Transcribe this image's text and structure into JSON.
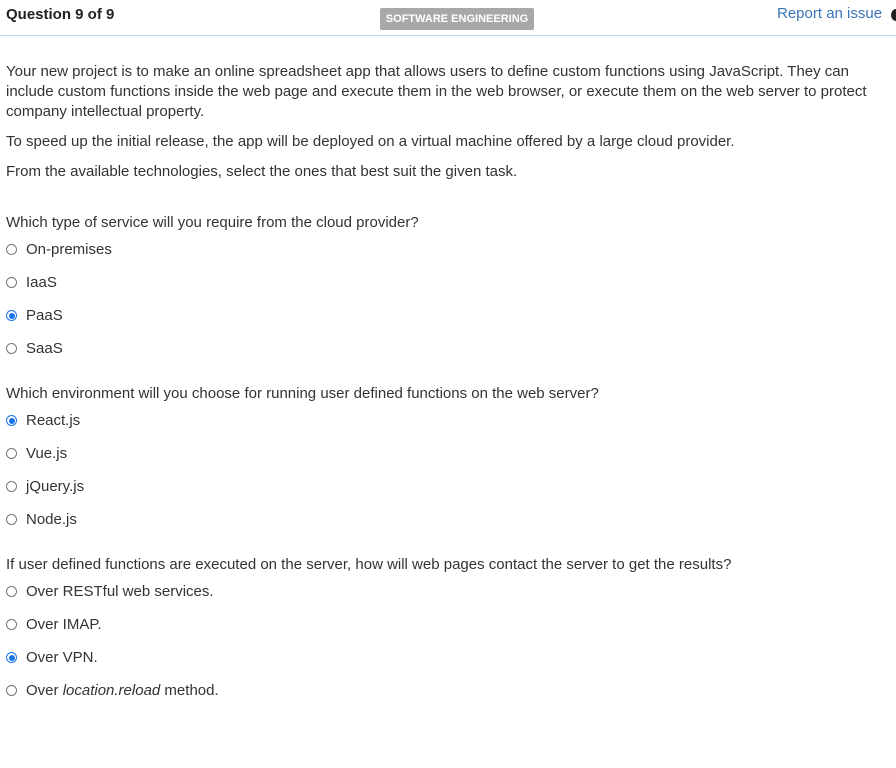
{
  "header": {
    "question_num": "Question 9 of 9",
    "category": "SOFTWARE ENGINEERING",
    "report_link": "Report an issue"
  },
  "intro": {
    "p1": "Your new project is to make an online spreadsheet app that allows users to define custom functions using JavaScript. They can include custom functions inside the web page and execute them in the web browser, or execute them on the web server to protect company intellectual property.",
    "p2": "To speed up the initial release, the app will be deployed on a virtual machine offered by a large cloud provider.",
    "p3": "From the available technologies, select the ones that best suit the given task."
  },
  "q1": {
    "prompt": "Which type of service will you require from the cloud provider?",
    "options": [
      "On-premises",
      "IaaS",
      "PaaS",
      "SaaS"
    ],
    "selected": "PaaS"
  },
  "q2": {
    "prompt": "Which environment will you choose for running user defined functions on the web server?",
    "options": [
      "React.js",
      "Vue.js",
      "jQuery.js",
      "Node.js"
    ],
    "selected": "React.js"
  },
  "q3": {
    "prompt": "If user defined functions are executed on the server, how will web pages contact the server to get the results?",
    "options": [
      "Over RESTful web services.",
      "Over IMAP.",
      "Over VPN."
    ],
    "option4": {
      "prefix": "Over ",
      "italic": "location.reload",
      "suffix": " method."
    },
    "selected": "Over VPN."
  },
  "colors": {
    "accent": "#1a73e8",
    "link": "#3b74b8",
    "badge": "#a8a8a8",
    "divider": "#b9d3ea"
  }
}
